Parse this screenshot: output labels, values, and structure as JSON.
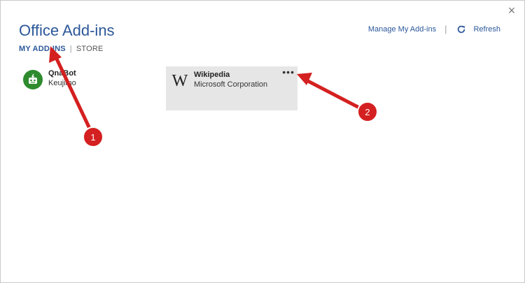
{
  "dialog": {
    "title": "Office Add-ins",
    "close_glyph": "×"
  },
  "tabs": [
    {
      "label": "MY ADD-INS",
      "active": true
    },
    {
      "label": "STORE",
      "active": false
    }
  ],
  "tab_separator": "|",
  "top_actions": {
    "manage_label": "Manage My Add-ins",
    "separator": "|",
    "refresh_label": "Refresh"
  },
  "addins": [
    {
      "name": "QnaBot",
      "publisher": "Keujimo",
      "icon": "robot-icon"
    },
    {
      "name": "Wikipedia",
      "publisher": "Microsoft Corporation",
      "icon": "wikipedia-logo",
      "logo_glyph": "W",
      "more_glyph": "•••"
    }
  ],
  "annotations": [
    {
      "number": "1"
    },
    {
      "number": "2"
    }
  ],
  "colors": {
    "accent": "#2b579a",
    "annotation_red": "#e02424",
    "card_bg": "#e6e6e6",
    "bot_green": "#2e8b2e"
  }
}
